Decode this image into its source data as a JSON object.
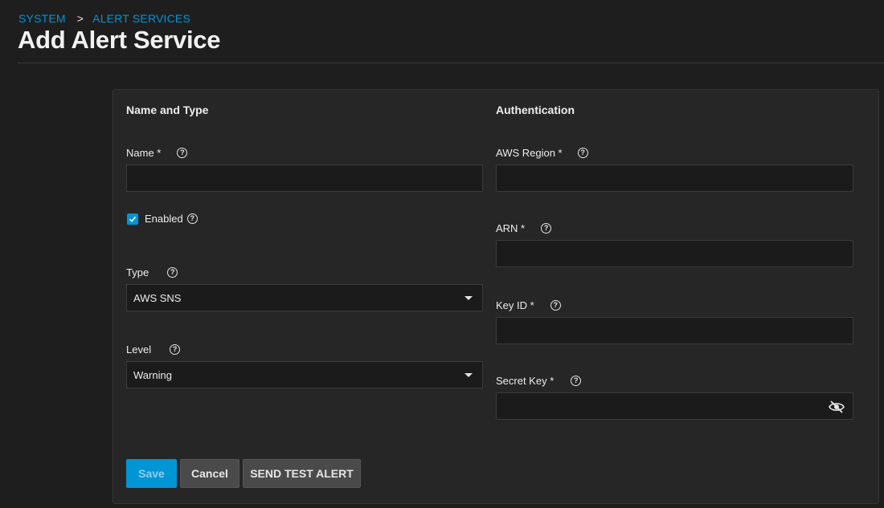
{
  "breadcrumb": {
    "items": [
      "SYSTEM",
      "ALERT SERVICES"
    ],
    "separator": ">"
  },
  "page": {
    "title": "Add Alert Service"
  },
  "form": {
    "left_section_title": "Name and Type",
    "right_section_title": "Authentication",
    "name": {
      "label": "Name *",
      "value": ""
    },
    "enabled": {
      "label": "Enabled",
      "checked": true
    },
    "type": {
      "label": "Type",
      "value": "AWS SNS"
    },
    "level": {
      "label": "Level",
      "value": "Warning"
    },
    "aws_region": {
      "label": "AWS Region *",
      "value": ""
    },
    "arn": {
      "label": "ARN *",
      "value": ""
    },
    "key_id": {
      "label": "Key ID *",
      "value": ""
    },
    "secret_key": {
      "label": "Secret Key *",
      "value": ""
    },
    "help_glyph": "?"
  },
  "buttons": {
    "save": "Save",
    "cancel": "Cancel",
    "send_test": "SEND TEST ALERT"
  },
  "colors": {
    "accent": "#0095d5",
    "background": "#1e1e1e",
    "card": "#262626"
  }
}
